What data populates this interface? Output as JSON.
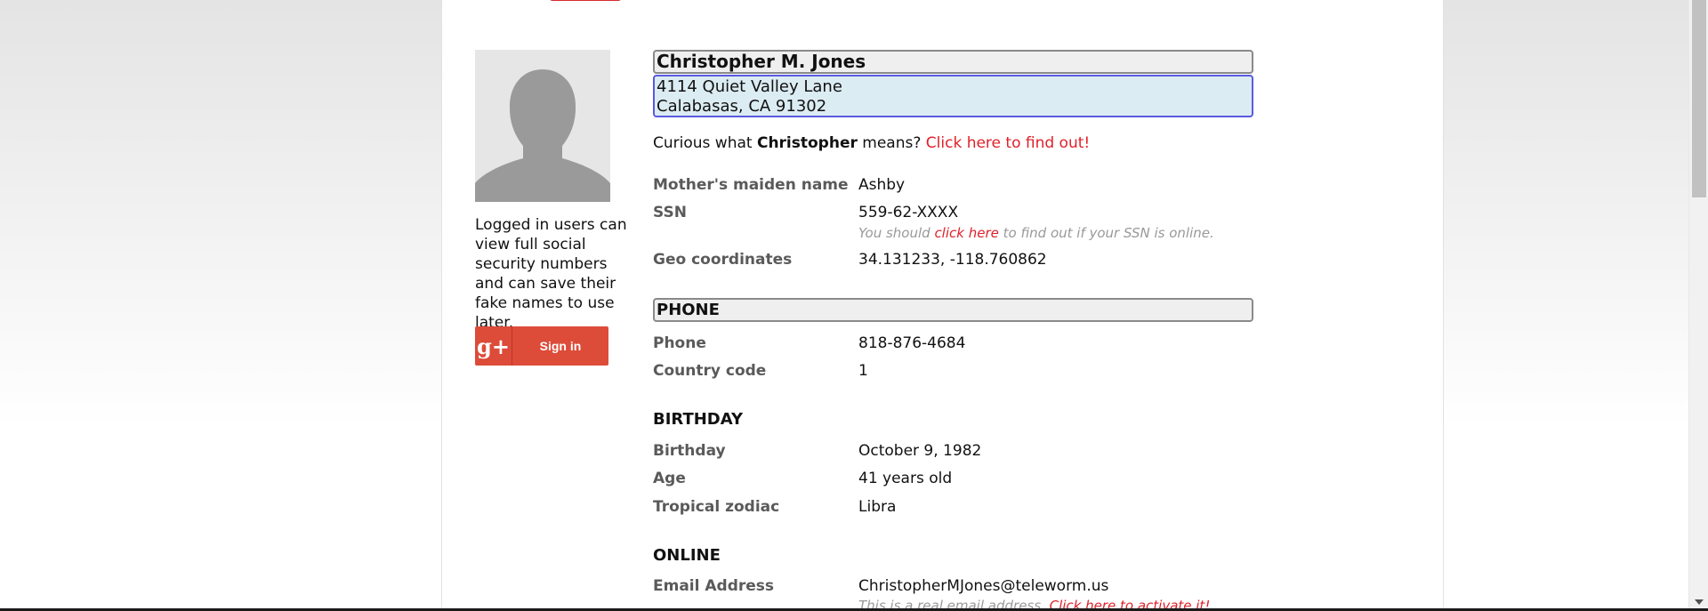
{
  "person": {
    "name": "Christopher M. Jones",
    "address_line1": "4114 Quiet Valley Lane",
    "address_line2": "Calabasas, CA 91302"
  },
  "curious": {
    "prefix": "Curious what ",
    "first_name": "Christopher",
    "middle": " means? ",
    "link": "Click here to find out!"
  },
  "sidebar": {
    "login_note": "Logged in users can view full social security numbers and can save their fake names to use later.",
    "signin_icon": "g+",
    "signin_label": "Sign in"
  },
  "details": {
    "maiden_label": "Mother's maiden name",
    "maiden_value": "Ashby",
    "ssn_label": "SSN",
    "ssn_value": "559-62-XXXX",
    "ssn_hint_prefix": "You should ",
    "ssn_hint_link": "click here",
    "ssn_hint_suffix": " to find out if your SSN is online.",
    "geo_label": "Geo coordinates",
    "geo_value": "34.131233, -118.760862"
  },
  "phone": {
    "section": "PHONE",
    "phone_label": "Phone",
    "phone_value": "818-876-4684",
    "country_label": "Country code",
    "country_value": "1"
  },
  "birthday": {
    "section": "BIRTHDAY",
    "birthday_label": "Birthday",
    "birthday_value": "October 9, 1982",
    "age_label": "Age",
    "age_value": "41 years old",
    "zodiac_label": "Tropical zodiac",
    "zodiac_value": "Libra"
  },
  "online": {
    "section": "ONLINE",
    "email_label": "Email Address",
    "email_value": "ChristopherMJones@teleworm.us",
    "email_hint_prefix": "This is a real email address. ",
    "email_hint_link": "Click here to activate it!"
  },
  "colors": {
    "accent_red": "#e0202a",
    "google_red": "#dd4b39",
    "address_bg": "#dcecf3"
  }
}
